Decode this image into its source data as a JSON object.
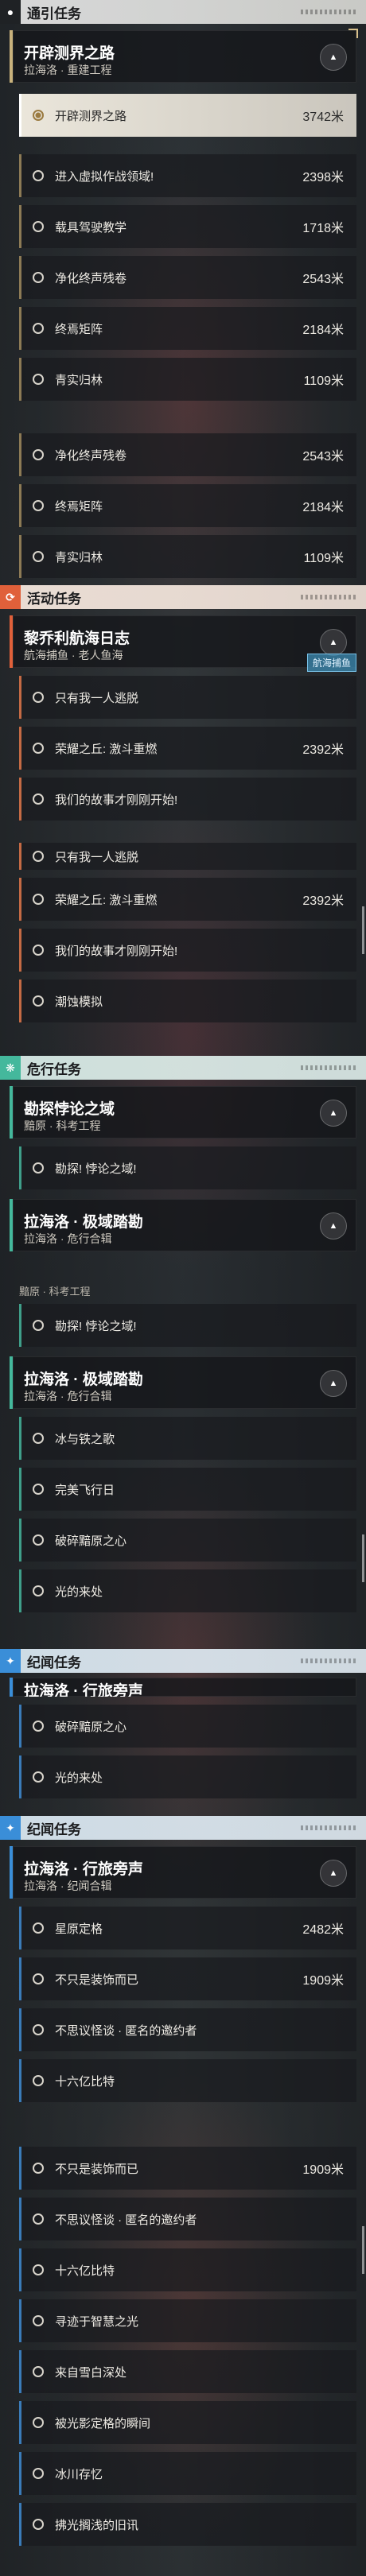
{
  "sections": {
    "guide": {
      "label": "通引任务"
    },
    "event": {
      "label": "活动任务"
    },
    "danger": {
      "label": "危行任务"
    },
    "chron": {
      "label": "纪闻任务"
    }
  },
  "colors": {
    "guide": "#c9b27c",
    "event": "#e0603a",
    "danger": "#44b89c",
    "chron": "#3a8ed8"
  },
  "icons": {
    "guide": "map-pin-icon",
    "event": "event-icon",
    "danger": "danger-icon",
    "chron": "star-icon",
    "collapse": "chevron-up-icon"
  },
  "panel1": {
    "card": {
      "title": "开辟测界之路",
      "sub": "拉海洛 · 重建工程"
    },
    "rows": [
      {
        "title": "开辟测界之路",
        "dist": "3742米",
        "active": true
      },
      {
        "title": "进入虚拟作战领域!",
        "dist": "2398米"
      },
      {
        "title": "载具驾驶教学",
        "dist": "1718米"
      },
      {
        "title": "净化终声残卷",
        "dist": "2543米"
      },
      {
        "title": "终焉矩阵",
        "dist": "2184米"
      },
      {
        "title": "青实归林",
        "dist": "1109米"
      }
    ]
  },
  "panel2": {
    "rows": [
      {
        "title": "净化终声残卷",
        "dist": "2543米"
      },
      {
        "title": "终焉矩阵",
        "dist": "2184米"
      },
      {
        "title": "青实归林",
        "dist": "1109米"
      }
    ]
  },
  "panel3": {
    "card": {
      "title": "黎乔利航海日志",
      "sub": "航海捕鱼 · 老人鱼海",
      "badge": "航海捕鱼"
    },
    "rows": [
      {
        "title": "只有我一人逃脱",
        "dist": ""
      },
      {
        "title": "荣耀之丘: 激斗重燃",
        "dist": "2392米"
      },
      {
        "title": "我们的故事才刚刚开始!",
        "dist": ""
      }
    ]
  },
  "panel4": {
    "rows": [
      {
        "title": "只有我一人逃脱",
        "dist": ""
      },
      {
        "title": "荣耀之丘: 激斗重燃",
        "dist": "2392米"
      },
      {
        "title": "我们的故事才刚刚开始!",
        "dist": ""
      },
      {
        "title": "潮蚀模拟",
        "dist": ""
      }
    ]
  },
  "panel5": {
    "card": {
      "title": "勘探悖论之域",
      "sub": "黯原 · 科考工程"
    },
    "rows": [
      {
        "title": "勘探! 悖论之域!",
        "dist": ""
      }
    ],
    "card2": {
      "title": "拉海洛 · 极域踏勘",
      "sub": "拉海洛 · 危行合辑"
    }
  },
  "panel6": {
    "top_label": "黯原 · 科考工程",
    "rows": [
      {
        "title": "勘探! 悖论之域!",
        "dist": ""
      }
    ],
    "card": {
      "title": "拉海洛 · 极域踏勘",
      "sub": "拉海洛 · 危行合辑"
    },
    "rows2": [
      {
        "title": "冰与铁之歌",
        "dist": ""
      },
      {
        "title": "完美飞行日",
        "dist": ""
      },
      {
        "title": "破碎黯原之心",
        "dist": ""
      },
      {
        "title": "光的来处",
        "dist": ""
      }
    ]
  },
  "panel7": {
    "peek": "拉海洛 · 行旅旁声",
    "rows": [
      {
        "title": "破碎黯原之心",
        "dist": ""
      },
      {
        "title": "光的来处",
        "dist": ""
      }
    ]
  },
  "panel8": {
    "card": {
      "title": "拉海洛 · 行旅旁声",
      "sub": "拉海洛 · 纪闻合辑"
    },
    "rows": [
      {
        "title": "星原定格",
        "dist": "2482米"
      },
      {
        "title": "不只是装饰而已",
        "dist": "1909米"
      },
      {
        "title": "不思议怪谈 · 匿名的邀约者",
        "dist": ""
      },
      {
        "title": "十六亿比特",
        "dist": ""
      }
    ]
  },
  "panel9": {
    "rows": [
      {
        "title": "不只是装饰而已",
        "dist": "1909米"
      },
      {
        "title": "不思议怪谈 · 匿名的邀约者",
        "dist": ""
      },
      {
        "title": "十六亿比特",
        "dist": ""
      },
      {
        "title": "寻迹于智慧之光",
        "dist": ""
      },
      {
        "title": "来自雪白深处",
        "dist": ""
      },
      {
        "title": "被光影定格的瞬间",
        "dist": ""
      },
      {
        "title": "冰川存忆",
        "dist": ""
      },
      {
        "title": "拂光搁浅的旧讯",
        "dist": ""
      }
    ]
  }
}
